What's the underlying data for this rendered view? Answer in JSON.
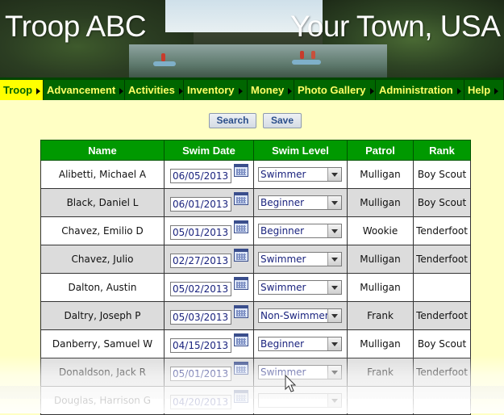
{
  "header": {
    "title_left": "Troop ABC",
    "title_right": "Your Town, USA"
  },
  "nav": {
    "items": [
      {
        "label": "Troop",
        "active": true
      },
      {
        "label": "Advancement",
        "active": false
      },
      {
        "label": "Activities",
        "active": false
      },
      {
        "label": "Inventory",
        "active": false
      },
      {
        "label": "Money",
        "active": false
      },
      {
        "label": "Photo Gallery",
        "active": false
      },
      {
        "label": "Administration",
        "active": false
      },
      {
        "label": "Help",
        "active": false
      }
    ]
  },
  "toolbar": {
    "search_label": "Search",
    "save_label": "Save"
  },
  "table": {
    "columns": [
      "Name",
      "Swim Date",
      "Swim Level",
      "Patrol",
      "Rank"
    ],
    "rows": [
      {
        "name": "Alibetti, Michael A",
        "swim_date": "06/05/2013",
        "swim_level": "Swimmer",
        "patrol": "Mulligan",
        "rank": "Boy Scout"
      },
      {
        "name": "Black, Daniel L",
        "swim_date": "06/01/2013",
        "swim_level": "Beginner",
        "patrol": "Mulligan",
        "rank": "Boy Scout"
      },
      {
        "name": "Chavez, Emilio D",
        "swim_date": "05/01/2013",
        "swim_level": "Beginner",
        "patrol": "Wookie",
        "rank": "Tenderfoot"
      },
      {
        "name": "Chavez, Julio",
        "swim_date": "02/27/2013",
        "swim_level": "Swimmer",
        "patrol": "Mulligan",
        "rank": "Tenderfoot"
      },
      {
        "name": "Dalton, Austin",
        "swim_date": "05/02/2013",
        "swim_level": "Swimmer",
        "patrol": "Mulligan",
        "rank": ""
      },
      {
        "name": "Daltry, Joseph P",
        "swim_date": "05/03/2013",
        "swim_level": "Non-Swimmer",
        "patrol": "Frank",
        "rank": "Tenderfoot"
      },
      {
        "name": "Danberry, Samuel W",
        "swim_date": "04/15/2013",
        "swim_level": "Beginner",
        "patrol": "Mulligan",
        "rank": "Boy Scout"
      },
      {
        "name": "Donaldson, Jack R",
        "swim_date": "05/01/2013",
        "swim_level": "Swimmer",
        "patrol": "Frank",
        "rank": "Tenderfoot"
      },
      {
        "name": "Douglas, Harrison G",
        "swim_date": "04/20/2013",
        "swim_level": "",
        "patrol": "",
        "rank": ""
      }
    ]
  },
  "colors": {
    "nav_bg": "#006600",
    "nav_text": "#ffff66",
    "nav_active_bg": "#ffff00",
    "header_row_bg": "#009900",
    "page_bg": "#ffffc4"
  }
}
